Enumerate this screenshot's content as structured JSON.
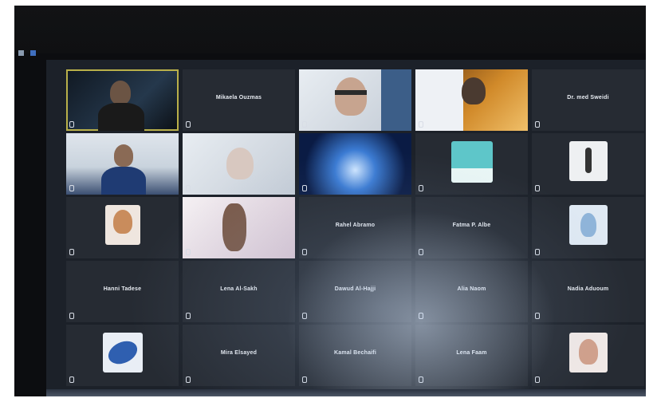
{
  "participants": [
    {
      "name": "",
      "label": "",
      "video": "dark-person",
      "active": true
    },
    {
      "name": "Mikaela Ouzmas",
      "label": "",
      "video": "none"
    },
    {
      "name": "",
      "label": "",
      "video": "older-man"
    },
    {
      "name": "",
      "label": "",
      "video": "warm"
    },
    {
      "name": "Dr. med Sweidi",
      "label": "",
      "video": "none"
    },
    {
      "name": "",
      "label": "",
      "video": "office-person"
    },
    {
      "name": "",
      "label": "",
      "video": "light-face"
    },
    {
      "name": "",
      "label": "",
      "video": "blue-globe"
    },
    {
      "name": "",
      "label": "",
      "video": "avatar-teal"
    },
    {
      "name": "",
      "label": "",
      "video": "avatar-figure"
    },
    {
      "name": "",
      "label": "",
      "video": "avatar-portrait"
    },
    {
      "name": "",
      "label": "",
      "video": "pink-hand"
    },
    {
      "name": "Rahel Abramo",
      "label": "",
      "video": "none"
    },
    {
      "name": "Fatma P. Albe",
      "label": "",
      "video": "none"
    },
    {
      "name": "",
      "label": "",
      "video": "avatar-figure2"
    },
    {
      "name": "Hanni Tadese",
      "label": "",
      "video": "none"
    },
    {
      "name": "Lena Al-Sakh",
      "label": "",
      "video": "none"
    },
    {
      "name": "Dawud Al-Hajji",
      "label": "",
      "video": "none"
    },
    {
      "name": "Alia Naom",
      "label": "",
      "video": "none"
    },
    {
      "name": "Nadia Aduoum",
      "label": "",
      "video": "none"
    },
    {
      "name": "",
      "label": "",
      "video": "avatar-bird"
    },
    {
      "name": "Mira Elsayed",
      "label": "",
      "video": "none"
    },
    {
      "name": "Kamal Bechaifi",
      "label": "",
      "video": "none"
    },
    {
      "name": "Lena Faam",
      "label": "",
      "video": "none"
    },
    {
      "name": "",
      "label": "",
      "video": "avatar-woman"
    }
  ],
  "colors": {
    "active_border": "#b9b04a",
    "tile_bg": "#262b33",
    "accent_button": "#5aa8e8"
  }
}
